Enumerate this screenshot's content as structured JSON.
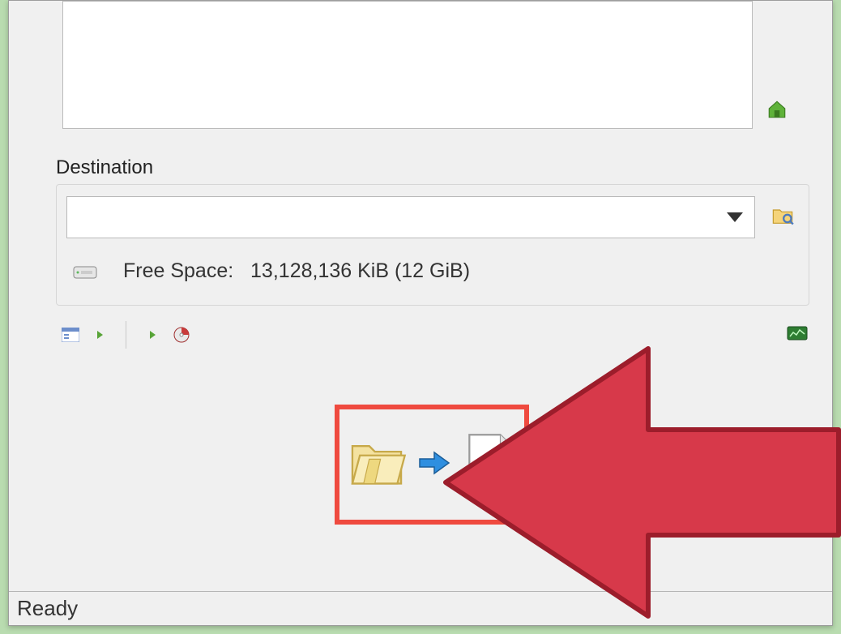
{
  "destination": {
    "label": "Destination",
    "selected": "",
    "free_space_label": "Free Space:",
    "free_space_value": "13,128,136 KiB  (12 GiB)"
  },
  "status": "Ready",
  "icons": {
    "add_home": "home-plus-icon",
    "browse": "folder-search-icon",
    "drive": "hard-drive-icon",
    "options_panel": "panel-options-icon",
    "play": "play-icon",
    "burn": "burn-disc-icon",
    "monitor": "monitor-icon",
    "folder": "open-folder-icon",
    "arrow": "blue-arrow-icon",
    "disc_image": "disc-image-icon"
  },
  "colors": {
    "highlight_border": "#ef4a3f",
    "arrow_fill": "#d7394a",
    "arrow_stroke": "#9c1d2b"
  }
}
